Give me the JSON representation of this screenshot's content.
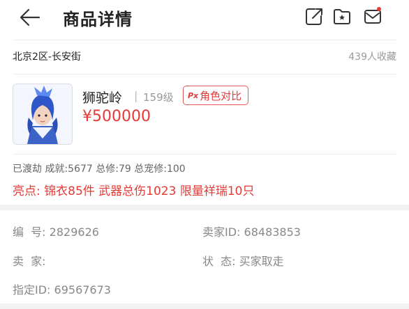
{
  "header": {
    "title": "商品详情",
    "icons": [
      "back-arrow-icon",
      "share-icon",
      "bookmark-icon",
      "message-icon"
    ],
    "notification_dot_color": "#e63a3a"
  },
  "server": {
    "name": "北京2区-长安街",
    "favorites": "439人收藏"
  },
  "character": {
    "name": "狮驼岭",
    "separator": "|",
    "level": "159级",
    "compare_badge": "Px",
    "compare_label": "角色对比",
    "price": "¥500000"
  },
  "stats": {
    "line": "已渡劫 成就:5677 总修:79 总宠修:100"
  },
  "highlights": {
    "label": "亮点:",
    "value": "锦衣85件 武器总伤1023 限量祥瑞10只"
  },
  "details": {
    "id_label": "编  号:",
    "id_value": "2829626",
    "seller_id_label": "卖家ID:",
    "seller_id_value": "68483853",
    "seller_label": "卖  家:",
    "seller_value": "",
    "status_label": "状  态:",
    "status_value": "买家取走",
    "designated_id_label": "指定ID:",
    "designated_id_value": "69567673"
  },
  "colors": {
    "accent": "#e53935",
    "muted": "#888888",
    "divider": "#f2f2f2"
  }
}
